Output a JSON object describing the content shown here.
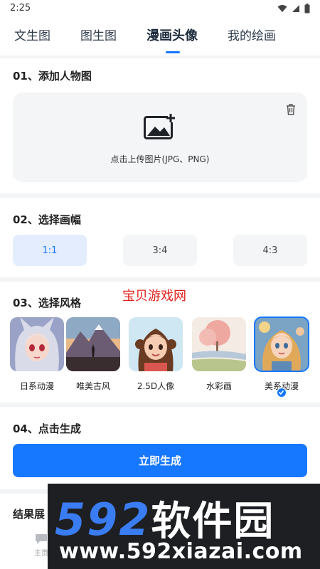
{
  "status_bar": {
    "time": "2:25"
  },
  "tabs": [
    {
      "label": "文生图"
    },
    {
      "label": "图生图"
    },
    {
      "label": "漫画头像"
    },
    {
      "label": "我的绘画"
    }
  ],
  "step1": {
    "title": "01、添加人物图",
    "upload_hint": "点击上传图片(JPG、PNG)"
  },
  "step2": {
    "title": "02、选择画幅",
    "ratios": [
      "1:1",
      "3:4",
      "4:3"
    ],
    "selected": "1:1"
  },
  "step3": {
    "title": "03、选择风格",
    "styles": [
      {
        "label": "日系动漫"
      },
      {
        "label": "唯美古风"
      },
      {
        "label": "2.5D人像"
      },
      {
        "label": "水彩画"
      },
      {
        "label": "美系动漫"
      }
    ],
    "selected": "美系动漫"
  },
  "step4": {
    "title": "04、点击生成",
    "button": "立即生成"
  },
  "results": {
    "title": "结果展"
  },
  "bottom_nav": {
    "home_label": "主页"
  },
  "watermarks": {
    "red_text": "宝贝游戏网",
    "banner_digits": "592",
    "banner_cn": "软件园",
    "banner_url": "www.592xiazai.com"
  },
  "colors": {
    "accent": "#1677ff",
    "selected_ratio_bg": "#e3edfd",
    "watermark_red": "#e0201b"
  }
}
